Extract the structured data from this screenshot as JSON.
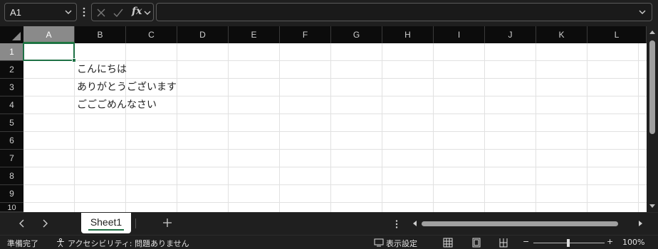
{
  "formula_bar": {
    "name_box_value": "A1",
    "fx_label": "fx",
    "formula_value": ""
  },
  "grid": {
    "column_headers": [
      "A",
      "B",
      "C",
      "D",
      "E",
      "F",
      "G",
      "H",
      "I",
      "J",
      "K",
      "L"
    ],
    "row_headers": [
      "1",
      "2",
      "3",
      "4",
      "5",
      "6",
      "7",
      "8",
      "9",
      "10"
    ],
    "selected_cell": "A1",
    "cells": [
      {
        "ref": "B2",
        "value": "こんにちは"
      },
      {
        "ref": "B3",
        "value": "ありがとうございます"
      },
      {
        "ref": "B4",
        "value": "ごごごめんなさい"
      }
    ]
  },
  "sheet_tabs": {
    "tabs": [
      {
        "label": "Sheet1",
        "active": true
      }
    ],
    "add_label": "+"
  },
  "status_bar": {
    "ready": "準備完了",
    "accessibility": "アクセシビリティ: 問題ありません",
    "display_settings": "表示設定",
    "zoom_minus": "−",
    "zoom_plus": "+",
    "zoom_level": "100%"
  },
  "colors": {
    "accent": "#1e7145",
    "grid_line": "#e1e1e1",
    "header_bg": "#0c0c0c",
    "selected_header_bg": "#8a8a8a"
  }
}
